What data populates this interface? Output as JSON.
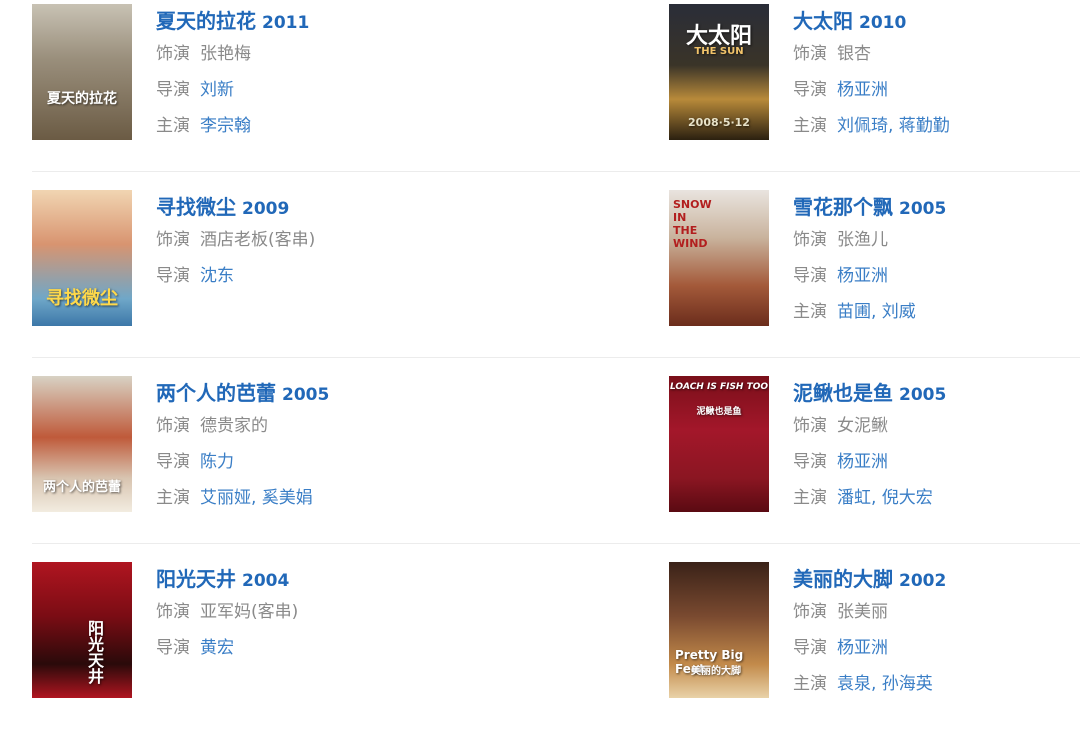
{
  "labels": {
    "role": "饰演",
    "director": "导演",
    "cast": "主演"
  },
  "films": [
    {
      "title": "夏天的拉花",
      "year": "2011",
      "role": "张艳梅",
      "director": "刘新",
      "cast": "李宗翰",
      "poster_icon": "poster-summer-lahua",
      "poster_text": "夏天的拉花"
    },
    {
      "title": "大太阳",
      "year": "2010",
      "role": "银杏",
      "director": "杨亚洲",
      "cast": "刘佩琦, 蒋勤勤",
      "poster_icon": "poster-the-sun",
      "poster_text": "大太阳",
      "poster_text_en": "THE SUN",
      "poster_date": "2008·5·12"
    },
    {
      "title": "寻找微尘",
      "year": "2009",
      "role": "酒店老板(客串)",
      "director": "沈东",
      "cast": null,
      "poster_icon": "poster-xunzhao-weichen",
      "poster_text": "寻找微尘"
    },
    {
      "title": "雪花那个飘",
      "year": "2005",
      "role": "张渔儿",
      "director": "杨亚洲",
      "cast": "苗圃, 刘威",
      "poster_icon": "poster-snow-in-the-wind",
      "poster_text_en": "SNOW IN THE WIND"
    },
    {
      "title": "两个人的芭蕾",
      "year": "2005",
      "role": "德贵家的",
      "director": "陈力",
      "cast": "艾丽娅, 奚美娟",
      "poster_icon": "poster-two-person-ballet",
      "poster_text": "两个人的芭蕾"
    },
    {
      "title": "泥鳅也是鱼",
      "year": "2005",
      "role": "女泥鳅",
      "director": "杨亚洲",
      "cast": "潘虹, 倪大宏",
      "poster_icon": "poster-loach-is-fish-too",
      "poster_text_en": "LOACH IS FISH TOO",
      "poster_text": "泥鳅也是鱼"
    },
    {
      "title": "阳光天井",
      "year": "2004",
      "role": "亚军妈(客串)",
      "director": "黄宏",
      "cast": null,
      "poster_icon": "poster-sunny-courtyard",
      "poster_text": "阳光天井"
    },
    {
      "title": "美丽的大脚",
      "year": "2002",
      "role": "张美丽",
      "director": "杨亚洲",
      "cast": "袁泉, 孙海英",
      "poster_icon": "poster-pretty-big-feet",
      "poster_text_en": "Pretty Big Feet",
      "poster_text": "美丽的大脚"
    }
  ],
  "colors": {
    "title": "#2168b8",
    "link": "#3a7ec6",
    "label": "#8a8a8a",
    "divider": "#ececec"
  }
}
